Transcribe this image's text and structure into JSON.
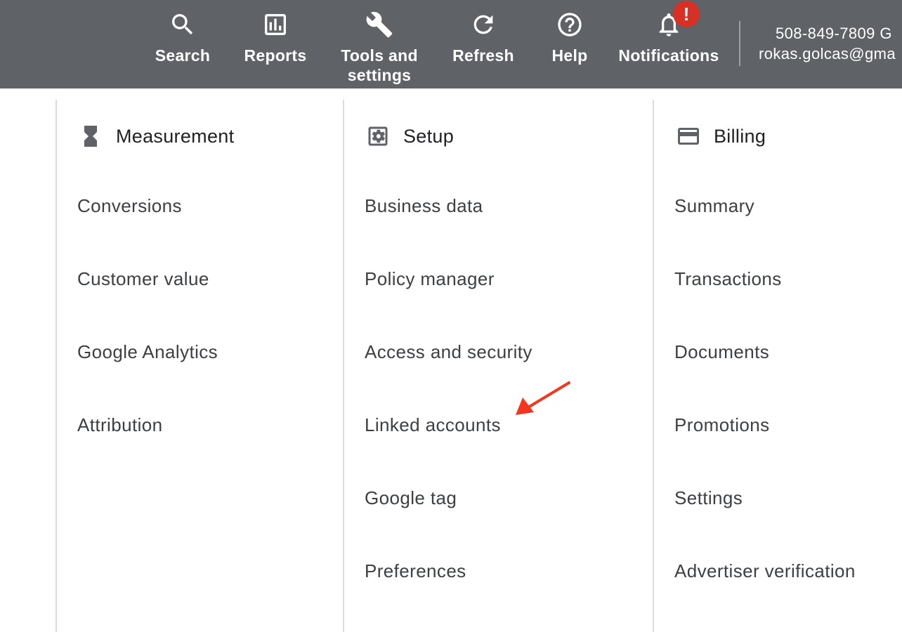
{
  "topbar": {
    "items": [
      {
        "label": "Search",
        "icon": "search-icon"
      },
      {
        "label": "Reports",
        "icon": "bar-chart-icon"
      },
      {
        "label": "Tools and\nsettings",
        "icon": "wrench-icon"
      },
      {
        "label": "Refresh",
        "icon": "refresh-icon"
      },
      {
        "label": "Help",
        "icon": "help-circle-icon"
      },
      {
        "label": "Notifications",
        "icon": "bell-icon"
      }
    ],
    "notification_badge": "!",
    "account": {
      "line1": "508-849-7809 G",
      "line2": "rokas.golcas@gma"
    }
  },
  "columns": [
    {
      "title": "Measurement",
      "icon": "hourglass-icon",
      "items": [
        "Conversions",
        "Customer value",
        "Google Analytics",
        "Attribution"
      ]
    },
    {
      "title": "Setup",
      "icon": "settings-box-icon",
      "items": [
        "Business data",
        "Policy manager",
        "Access and security",
        "Linked accounts",
        "Google tag",
        "Preferences"
      ]
    },
    {
      "title": "Billing",
      "icon": "credit-card-icon",
      "items": [
        "Summary",
        "Transactions",
        "Documents",
        "Promotions",
        "Settings",
        "Advertiser verification"
      ]
    }
  ],
  "colors": {
    "topbar_bg": "#5f6368",
    "badge": "#d93025",
    "annotation_arrow": "#f4361e",
    "divider": "#dadce0"
  }
}
